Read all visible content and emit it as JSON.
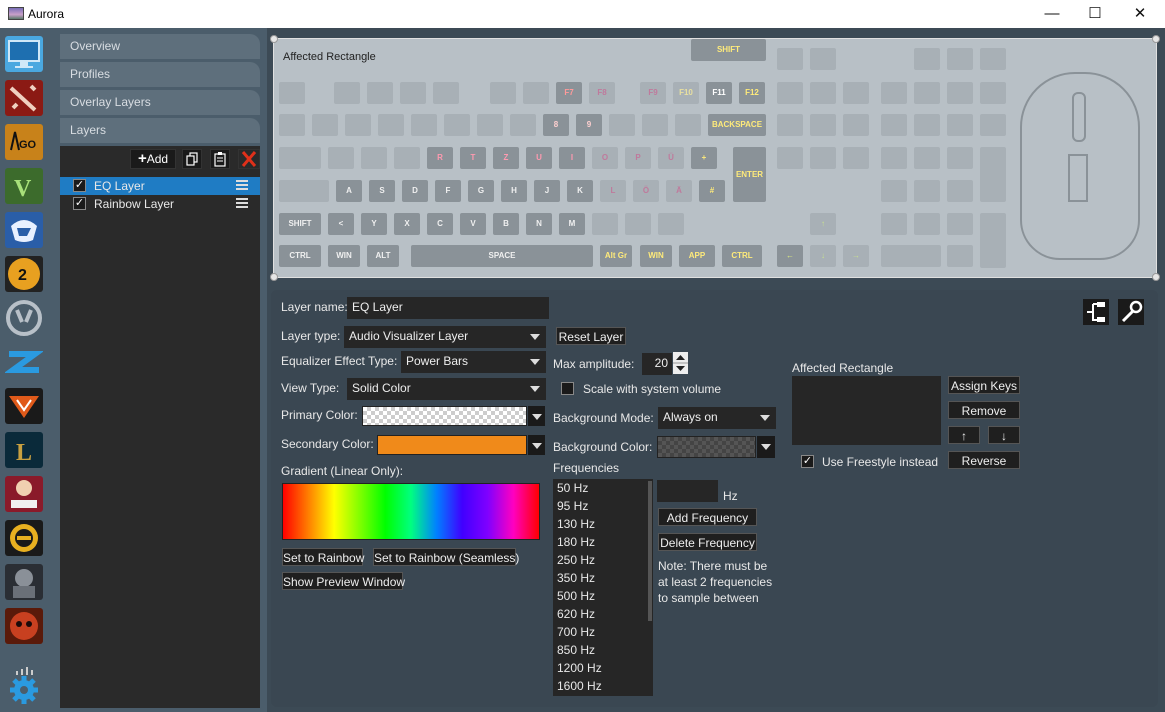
{
  "window": {
    "title": "Aurora",
    "minimize": "—",
    "maximize": "☐",
    "close": "✕"
  },
  "nav": {
    "tabs": [
      "Overview",
      "Profiles",
      "Overlay Layers",
      "Layers"
    ],
    "add_label": "Add",
    "layers": [
      {
        "name": "EQ Layer",
        "checked": true,
        "selected": true
      },
      {
        "name": "Rainbow Layer",
        "checked": true,
        "selected": false
      }
    ]
  },
  "apps": [
    "desktop",
    "dota-2",
    "cs-go",
    "gta-v",
    "rocket-league",
    "payday-2",
    "overwatch",
    "unknown-blue",
    "the-division",
    "league-of-legends",
    "hotline-miami",
    "unknown-circle",
    "call-of-duty",
    "doom"
  ],
  "preview": {
    "label": "Affected Rectangle",
    "keys": {
      "f7": "F7",
      "f8": "F8",
      "f9": "F9",
      "f10": "F10",
      "f11": "F11",
      "f12": "F12",
      "k8": "8",
      "k9": "9",
      "backspace": "BACKSPACE",
      "r": "R",
      "t": "T",
      "z": "Z",
      "u": "U",
      "i": "I",
      "o": "O",
      "p": "P",
      "ue": "Ü",
      "plus": "+",
      "enter": "ENTER",
      "a": "A",
      "s": "S",
      "d": "D",
      "f": "F",
      "g": "G",
      "h": "H",
      "j": "J",
      "k": "K",
      "l": "L",
      "oe": "Ö",
      "ae": "Ä",
      "hash": "#",
      "lt": "<",
      "y": "Y",
      "x": "X",
      "c": "C",
      "v": "V",
      "b": "B",
      "n": "N",
      "m": "M",
      "shift": "SHIFT",
      "shift_l": "SHIFT",
      "space": "SPACE",
      "altgr": "Alt Gr",
      "win": "WIN",
      "app": "APP",
      "ctrl": "CTRL",
      "ctrl_l": "CTRL",
      "win_l": "WIN",
      "alt": "ALT",
      "left": "←",
      "down": "↓",
      "right": "→",
      "up": "↑"
    }
  },
  "settings": {
    "layer_name_label": "Layer name:",
    "layer_name_value": "EQ Layer",
    "layer_type_label": "Layer type:",
    "layer_type_value": "Audio Visualizer Layer",
    "reset_layer": "Reset Layer",
    "eq_type_label": "Equalizer Effect Type:",
    "eq_type_value": "Power Bars",
    "view_type_label": "View Type:",
    "view_type_value": "Solid Color",
    "primary_color_label": "Primary Color:",
    "secondary_color_label": "Secondary Color:",
    "secondary_color": "#f08a1a",
    "gradient_label": "Gradient (Linear Only):",
    "set_rainbow": "Set to Rainbow",
    "set_rainbow_seamless": "Set to Rainbow (Seamless)",
    "show_preview": "Show Preview Window",
    "max_amplitude_label": "Max amplitude:",
    "max_amplitude_value": "20",
    "scale_volume_label": "Scale with system volume",
    "bg_mode_label": "Background Mode:",
    "bg_mode_value": "Always on",
    "bg_color_label": "Background Color:",
    "frequencies_label": "Frequencies",
    "frequencies": [
      "50 Hz",
      "95 Hz",
      "130 Hz",
      "180 Hz",
      "250 Hz",
      "350 Hz",
      "500 Hz",
      "620 Hz",
      "700 Hz",
      "850 Hz",
      "1200 Hz",
      "1600 Hz"
    ],
    "hz_unit": "Hz",
    "add_frequency": "Add Frequency",
    "delete_frequency": "Delete Frequency",
    "note": "Note: There must be at least 2 frequencies to sample between",
    "affected_rect_label": "Affected Rectangle",
    "assign_keys": "Assign Keys",
    "remove": "Remove",
    "up": "↑",
    "down": "↓",
    "reverse": "Reverse",
    "freestyle_label": "Use Freestyle instead"
  }
}
